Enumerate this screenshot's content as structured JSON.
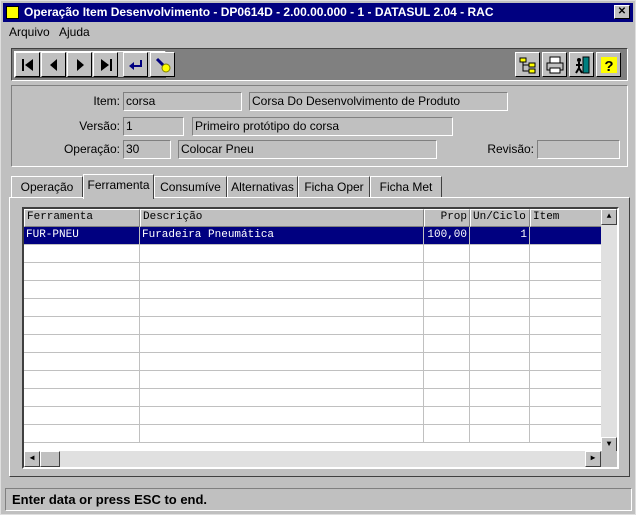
{
  "window": {
    "title": "Operação Item Desenvolvimento - DP0614D - 2.00.00.000 - 1 - DATASUL 2.04 - RAC",
    "close_label": "✕"
  },
  "menu": {
    "items": [
      "Arquivo",
      "Ajuda"
    ]
  },
  "toolbar": {
    "nav_icons": [
      "first-icon",
      "previous-icon",
      "next-icon",
      "last-icon",
      "goto-icon",
      "search-icon"
    ],
    "right_icons": [
      "tree-icon",
      "print-icon",
      "exit-icon",
      "help-icon"
    ]
  },
  "header": {
    "item_label": "Item:",
    "item_code": "corsa",
    "item_desc": "Corsa Do Desenvolvimento de Produto",
    "versao_label": "Versão:",
    "versao_code": "1",
    "versao_desc": "Primeiro protótipo do corsa",
    "operacao_label": "Operação:",
    "operacao_code": "30",
    "operacao_desc": "Colocar Pneu",
    "revisao_label": "Revisão:",
    "revisao_value": ""
  },
  "tabs": [
    "Operação",
    "Ferramenta",
    "Consumíve",
    "Alternativas",
    "Ficha Oper",
    "Ficha Met"
  ],
  "active_tab": 1,
  "grid": {
    "columns": [
      "Ferramenta",
      "Descrição",
      "Prop",
      "Un/Ciclo",
      "Item"
    ],
    "rows": [
      [
        "FUR-PNEU",
        "Furadeira Pneumática",
        "100,00",
        "1",
        ""
      ]
    ]
  },
  "status": {
    "text": "Enter data or press ESC to end."
  },
  "colors": {
    "title_bg": "#000080",
    "selection": "#000080",
    "face": "#c0c0c0"
  }
}
